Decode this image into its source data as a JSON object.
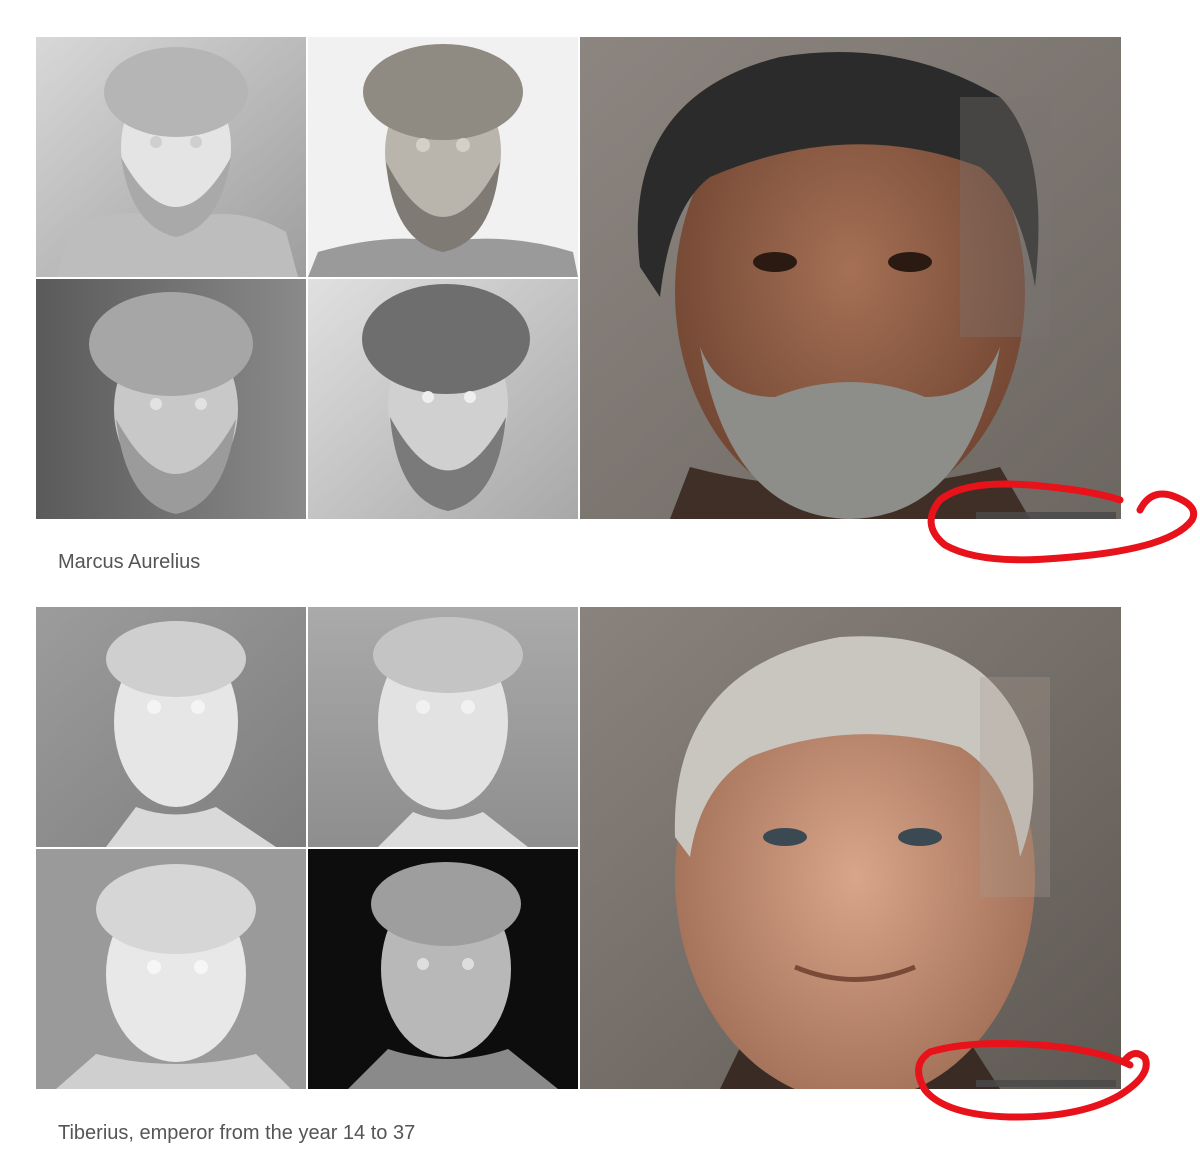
{
  "figures": [
    {
      "caption": "Marcus Aurelius",
      "statue_images": [
        "statue-bust-1",
        "statue-bust-2",
        "statue-bust-3",
        "statue-bust-4"
      ],
      "reconstruction_image": "ai-reconstruction-portrait",
      "annotation": "red-circle-watermark"
    },
    {
      "caption": "Tiberius, emperor from the year 14 to 37",
      "statue_images": [
        "statue-bust-1",
        "statue-bust-2",
        "statue-bust-3",
        "statue-bust-4"
      ],
      "reconstruction_image": "ai-reconstruction-portrait",
      "annotation": "red-circle-watermark"
    }
  ],
  "colors": {
    "annotation_red": "#e8121b",
    "caption_text": "#555555",
    "background": "#ffffff"
  }
}
